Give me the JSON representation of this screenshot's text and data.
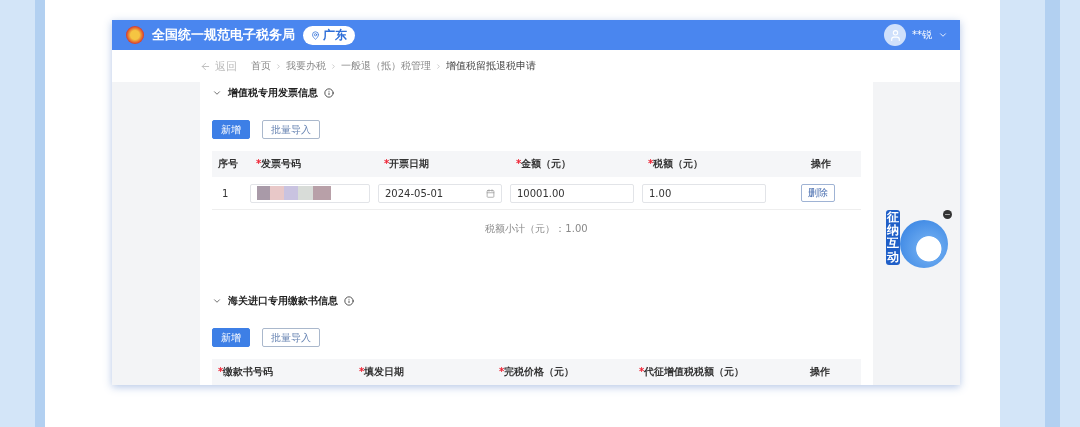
{
  "header": {
    "title": "全国统一规范电子税务局",
    "region": "广东",
    "user": "**锐"
  },
  "nav": {
    "back": "返回",
    "breadcrumb": [
      "首页",
      "我要办税",
      "一般退（抵）税管理",
      "增值税留抵退税申请"
    ]
  },
  "sections": [
    {
      "title": "增值税专用发票信息",
      "expanded": true,
      "buttons": [
        {
          "label": "新增",
          "kind": "primary"
        },
        {
          "label": "批量导入",
          "kind": "outline"
        }
      ],
      "columns": [
        {
          "label": "序号"
        },
        {
          "label": "发票号码",
          "required_mark": "*"
        },
        {
          "label": "开票日期",
          "required_mark": "*"
        },
        {
          "label": "金额（元）",
          "required_mark": "*"
        },
        {
          "label": "税额（元）",
          "required_mark": "*"
        },
        {
          "label": "操作"
        }
      ],
      "rows": [
        {
          "index": "1",
          "invoice_redacted": true,
          "date": "2024-05-01",
          "amount": "10001.00",
          "tax": "1.00",
          "action": "删除"
        }
      ],
      "subtotal": "税额小计（元）：1.00"
    },
    {
      "title": "海关进口专用缴款书信息",
      "expanded": true,
      "buttons": [
        {
          "label": "新增",
          "kind": "primary"
        },
        {
          "label": "批量导入",
          "kind": "outline"
        }
      ],
      "columns": [
        {
          "label": "缴款书号码",
          "required_mark": "*"
        },
        {
          "label": "填发日期",
          "required_mark": "*"
        },
        {
          "label": "完税价格（元）",
          "required_mark": "*"
        },
        {
          "label": "代征增值税税额（元）",
          "required_mark": "*"
        },
        {
          "label": "操作"
        }
      ]
    }
  ],
  "assistant": {
    "label": "征纳互动"
  }
}
